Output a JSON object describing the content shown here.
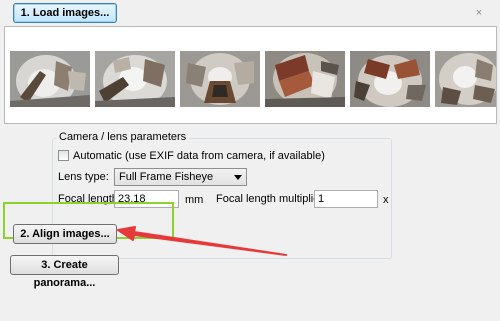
{
  "window": {
    "close_label": "×"
  },
  "buttons": {
    "load_images": "1. Load images...",
    "align_images": "2. Align images...",
    "create_panorama": "3. Create panorama..."
  },
  "camera": {
    "group_title": "Camera / lens parameters",
    "automatic_label": "Automatic (use EXIF data from camera, if available)",
    "automatic_checked": false,
    "lens_type_label": "Lens type:",
    "lens_type_value": "Full Frame Fisheye",
    "focal_length_label": "Focal length:",
    "focal_length_value": "23.18",
    "focal_length_unit": "mm",
    "multiplier_label": "Focal length multiplier:",
    "multiplier_value": "1",
    "multiplier_unit": "x"
  },
  "thumbnails": [
    {
      "name": "fisheye-image-1"
    },
    {
      "name": "fisheye-image-2"
    },
    {
      "name": "fisheye-image-3"
    },
    {
      "name": "fisheye-image-4"
    },
    {
      "name": "fisheye-image-5"
    },
    {
      "name": "fisheye-image-6"
    }
  ],
  "annotation": {
    "highlight_color": "#8cd22c",
    "arrow_color": "#e8393a"
  }
}
